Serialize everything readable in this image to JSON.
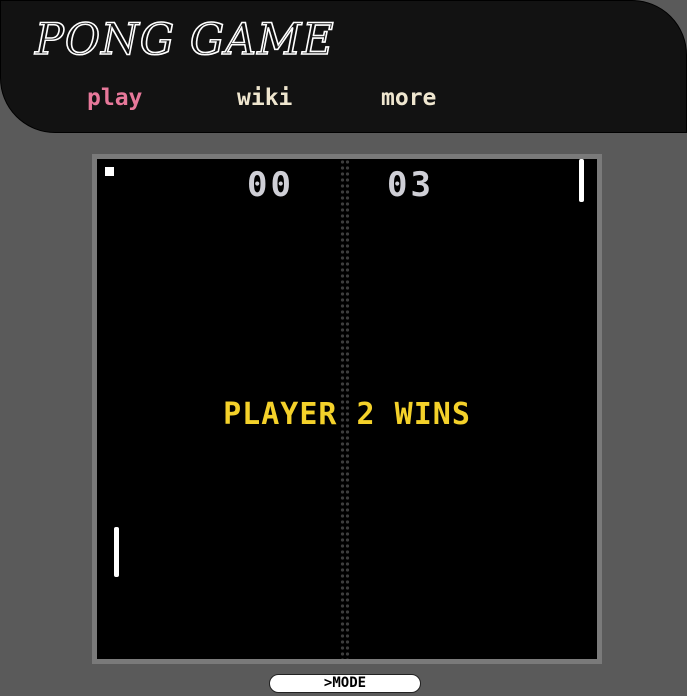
{
  "header": {
    "logo_text": "PONG GAME",
    "nav": {
      "play": "play",
      "wiki": "wiki",
      "more": "more"
    },
    "active_nav": "play"
  },
  "game": {
    "score_left": "00",
    "score_right": "03",
    "message": "PLAYER 2 WINS"
  },
  "controls": {
    "mode_label": ">MODE"
  },
  "colors": {
    "page_background": "#5a5a5a",
    "header_background": "#121212",
    "nav_active": "#e7789a",
    "nav_inactive": "#efe6cf",
    "message": "#f4d12a",
    "score": "#cfcfd6"
  }
}
